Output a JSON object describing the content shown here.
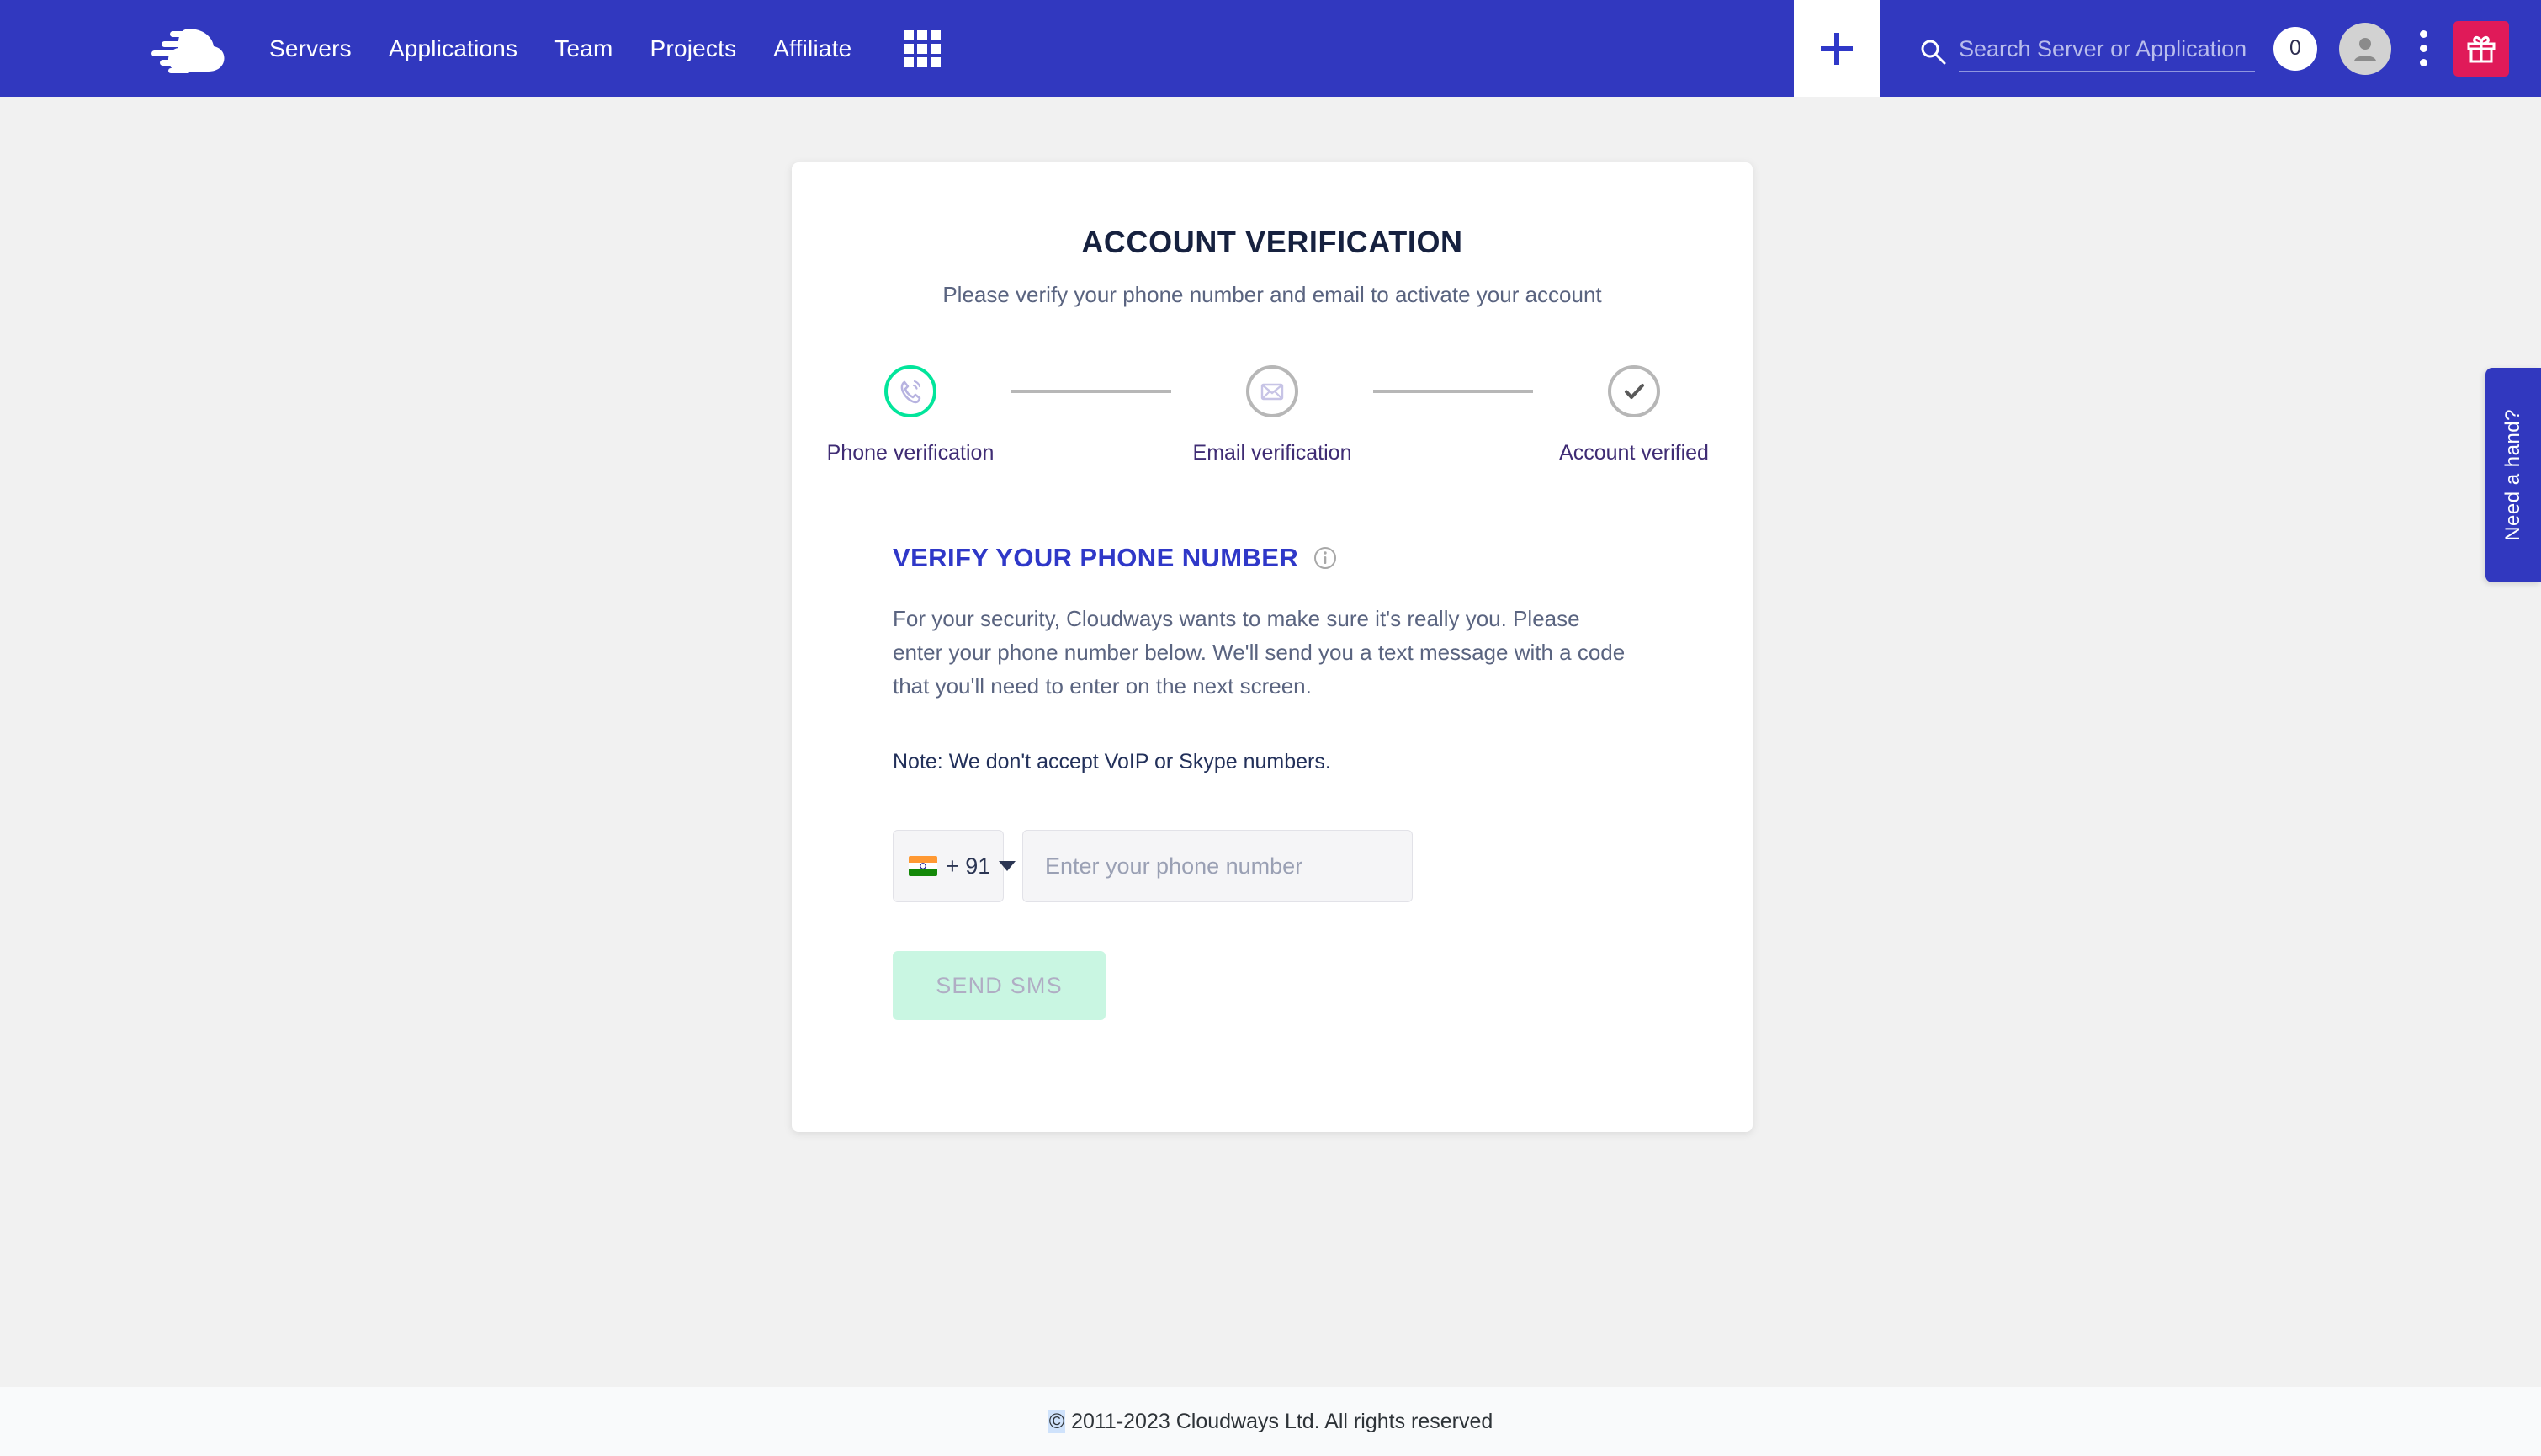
{
  "header": {
    "logo_icon": "cloudways-cloud-logo",
    "nav_items": [
      {
        "label": "Servers"
      },
      {
        "label": "Applications"
      },
      {
        "label": "Team"
      },
      {
        "label": "Projects"
      },
      {
        "label": "Affiliate"
      }
    ],
    "apps_grid_icon": "grid-apps-icon",
    "add_button_icon": "plus-icon",
    "search": {
      "icon": "search-icon",
      "placeholder": "Search Server or Application",
      "value": ""
    },
    "count_badge": "0",
    "avatar_icon": "user-avatar-icon",
    "kebab_icon": "more-vertical-icon",
    "gift_icon": "gift-icon",
    "colors": {
      "header_bg": "#3138bf",
      "gift_bg": "#e01a59"
    }
  },
  "card": {
    "title": "ACCOUNT VERIFICATION",
    "subtitle": "Please verify your phone number and email to activate your account",
    "stepper": [
      {
        "label": "Phone verification",
        "icon": "phone-ringing-icon",
        "state": "active"
      },
      {
        "label": "Email verification",
        "icon": "envelope-icon",
        "state": "inactive"
      },
      {
        "label": "Account verified",
        "icon": "check-icon",
        "state": "inactive"
      }
    ],
    "section": {
      "title": "VERIFY YOUR PHONE NUMBER",
      "info_icon": "info-circle-icon",
      "body": "For your security, Cloudways wants to make sure it's really you. Please enter your phone number below. We'll send you a text message with a code that you'll need to enter on the next screen.",
      "note": "Note: We don't accept VoIP or Skype numbers.",
      "country_code": {
        "flag_icon": "india-flag-icon",
        "code": "+ 91",
        "caret_icon": "chevron-down-icon"
      },
      "phone_input": {
        "placeholder": "Enter your phone number",
        "value": ""
      },
      "send_button": "SEND SMS"
    },
    "colors": {
      "title": "#16213f",
      "section_title": "#2f38c8",
      "active_step": "#02e59b",
      "send_button_bg": "#c9f6e2"
    }
  },
  "support_tab": {
    "label": "Need a hand?"
  },
  "footer": {
    "copyright_mark": "©",
    "text": " 2011-2023 Cloudways Ltd. All rights reserved"
  }
}
